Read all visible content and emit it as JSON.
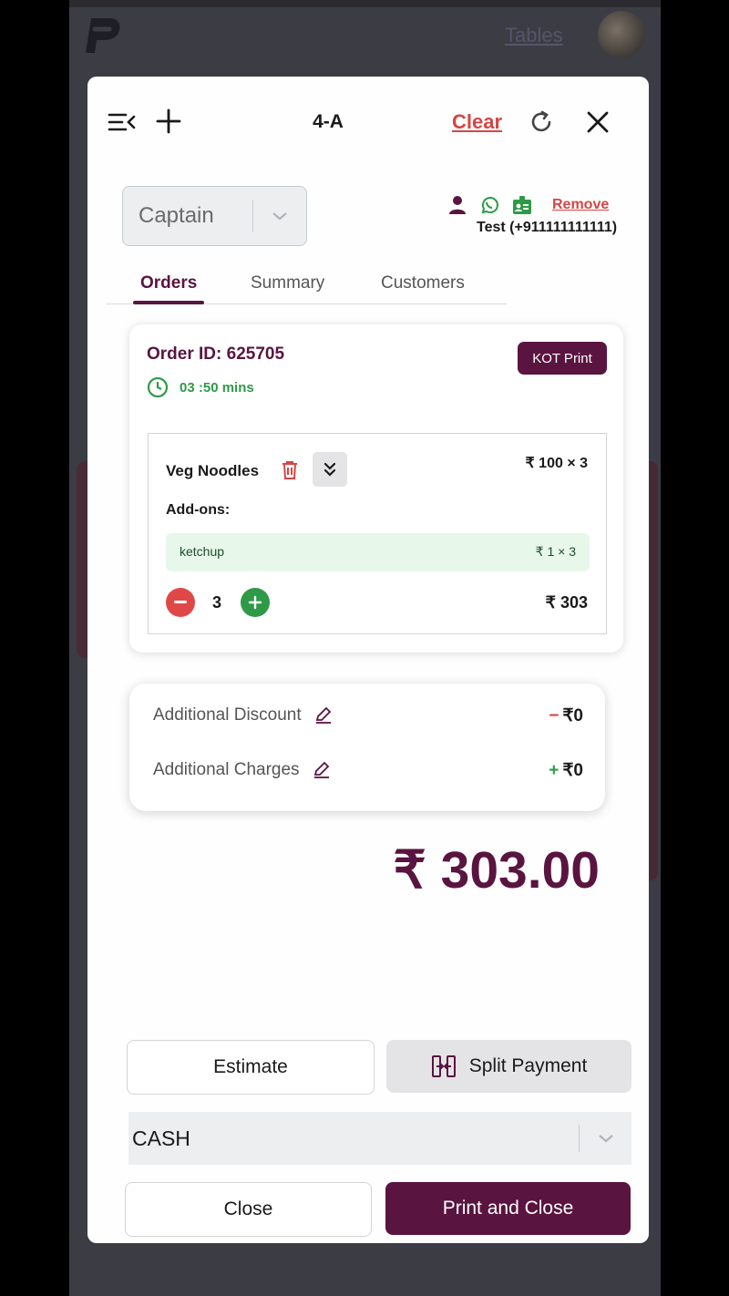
{
  "background": {
    "tables_link": "Tables"
  },
  "header": {
    "table_name": "4-A",
    "clear_label": "Clear"
  },
  "captain": {
    "selected": "Captain"
  },
  "customer": {
    "remove_label": "Remove",
    "name": "Test (+911111111111)"
  },
  "tabs": [
    {
      "label": "Orders",
      "active": true
    },
    {
      "label": "Summary",
      "active": false
    },
    {
      "label": "Customers",
      "active": false
    }
  ],
  "order": {
    "id_label": "Order ID: 625705",
    "timer": "03 :50 mins",
    "kot_label": "KOT Print",
    "item": {
      "name": "Veg Noodles",
      "price": "₹ 100 × 3",
      "addons_label": "Add-ons:",
      "addons": [
        {
          "name": "ketchup",
          "price": "₹ 1 × 3"
        }
      ],
      "quantity": "3",
      "total": "₹ 303"
    }
  },
  "adjustments": {
    "discount_label": "Additional Discount",
    "discount_value": "₹0",
    "charges_label": "Additional Charges",
    "charges_value": "₹0"
  },
  "grand_total": "₹ 303.00",
  "actions": {
    "estimate_label": "Estimate",
    "split_label": "Split Payment",
    "payment_method": "CASH",
    "close_label": "Close",
    "print_close_label": "Print and Close"
  },
  "colors": {
    "brand": "#5a1440",
    "danger": "#d64545",
    "success": "#2e9a48"
  }
}
